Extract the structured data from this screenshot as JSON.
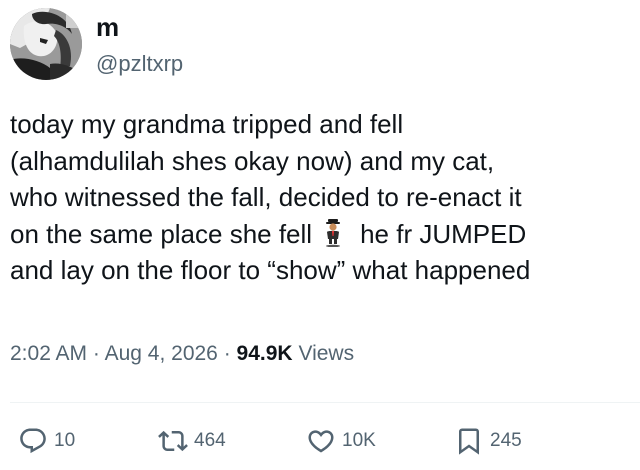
{
  "author": {
    "display_name": "m",
    "handle": "@pzltxrp",
    "avatar_icon": "avatar-image"
  },
  "tweet": {
    "lines": [
      "today my grandma tripped and fell",
      "(alhamdulilah shes okay now) and my cat,",
      "who witnessed the fall, decided to re-enact it",
      "on the same place she fell",
      "he fr JUMPED",
      "and lay on the floor to “show” what happened"
    ],
    "emoji_icon": "person-in-suit-levitating-emoji"
  },
  "meta": {
    "time": "2:02 AM",
    "separator": "·",
    "date": "Aug 4, 2026",
    "views_count": "94.9K",
    "views_label": "Views"
  },
  "actions": {
    "reply": {
      "count": "10",
      "icon": "reply-icon"
    },
    "retweet": {
      "count": "464",
      "icon": "retweet-icon"
    },
    "like": {
      "count": "10K",
      "icon": "heart-icon"
    },
    "bookmark": {
      "count": "245",
      "icon": "bookmark-icon"
    }
  },
  "colors": {
    "text": "#0f1419",
    "secondary": "#536471",
    "divider": "#eff3f4"
  }
}
